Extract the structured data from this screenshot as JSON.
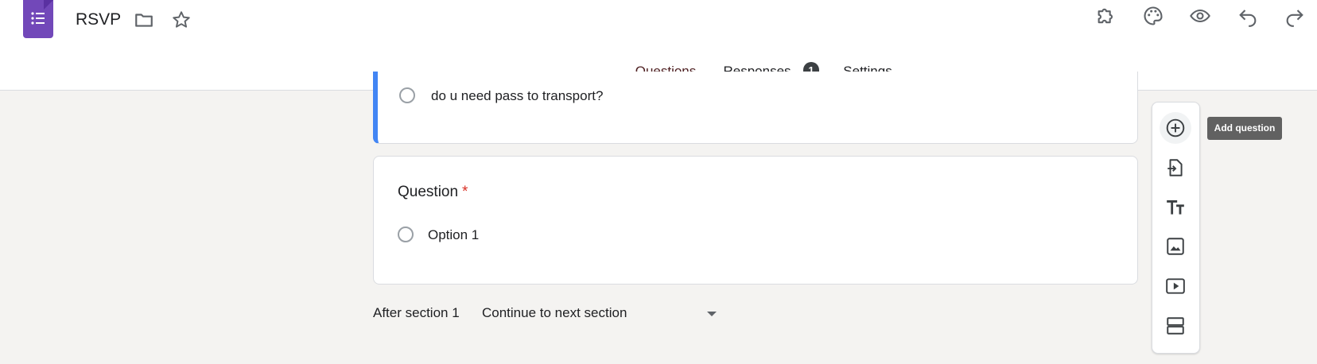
{
  "header": {
    "doc_title": "RSVP",
    "icons": {
      "app": "google-forms-logo",
      "folder": "folder-icon",
      "star": "star-icon",
      "addons": "puzzle-icon",
      "theme": "palette-icon",
      "preview": "eye-icon",
      "undo": "undo-icon",
      "redo": "redo-icon"
    }
  },
  "tabs": [
    {
      "label": "Questions",
      "active": true
    },
    {
      "label": "Responses",
      "badge": "1"
    },
    {
      "label": "Settings"
    }
  ],
  "previous_card": {
    "option_text": "do u need pass to transport?"
  },
  "question_card": {
    "title": "Question",
    "required_mark": "*",
    "option_text": "Option 1"
  },
  "after_section": {
    "label": "After section 1",
    "selected": "Continue to next section"
  },
  "toolbar": {
    "tooltip": "Add question",
    "tools": [
      "add-question-icon",
      "import-questions-icon",
      "add-title-icon",
      "add-image-icon",
      "add-video-icon",
      "add-section-icon"
    ]
  },
  "colors": {
    "accent": "#7248b9",
    "active_tab": "#5c2a2c",
    "card_border_active": "#4285f4",
    "required": "#d93025",
    "background": "#f4f3f1"
  }
}
